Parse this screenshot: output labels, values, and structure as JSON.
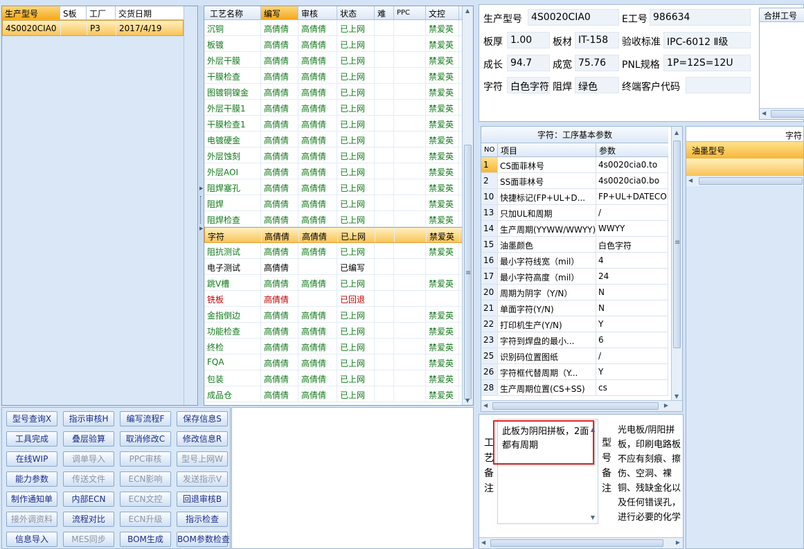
{
  "left_list": {
    "columns": [
      "生产型号",
      "S板",
      "工厂",
      "交货日期"
    ],
    "rows": [
      {
        "model": "4S0020CIA0",
        "s": "",
        "factory": "P3",
        "date": "2017/4/19"
      }
    ]
  },
  "process": {
    "columns": [
      "工艺名称",
      "编写",
      "审核",
      "状态",
      "难",
      "PPC",
      "文控"
    ],
    "rows": [
      {
        "name": "沉铜",
        "write": "高倩倩",
        "review": "高倩倩",
        "status": "已上网",
        "hard": "",
        "ppc": "",
        "doc": "禁爱英",
        "style": "green"
      },
      {
        "name": "板镀",
        "write": "高倩倩",
        "review": "高倩倩",
        "status": "已上网",
        "hard": "",
        "ppc": "",
        "doc": "禁爱英",
        "style": "green"
      },
      {
        "name": "外层干膜",
        "write": "高倩倩",
        "review": "高倩倩",
        "status": "已上网",
        "hard": "",
        "ppc": "",
        "doc": "禁爱英",
        "style": "green"
      },
      {
        "name": "干膜检查",
        "write": "高倩倩",
        "review": "高倩倩",
        "status": "已上网",
        "hard": "",
        "ppc": "",
        "doc": "禁爱英",
        "style": "green"
      },
      {
        "name": "图镀铜镍金",
        "write": "高倩倩",
        "review": "高倩倩",
        "status": "已上网",
        "hard": "",
        "ppc": "",
        "doc": "禁爱英",
        "style": "green"
      },
      {
        "name": "外层干膜1",
        "write": "高倩倩",
        "review": "高倩倩",
        "status": "已上网",
        "hard": "",
        "ppc": "",
        "doc": "禁爱英",
        "style": "green"
      },
      {
        "name": "干膜检查1",
        "write": "高倩倩",
        "review": "高倩倩",
        "status": "已上网",
        "hard": "",
        "ppc": "",
        "doc": "禁爱英",
        "style": "green"
      },
      {
        "name": "电镀硬金",
        "write": "高倩倩",
        "review": "高倩倩",
        "status": "已上网",
        "hard": "",
        "ppc": "",
        "doc": "禁爱英",
        "style": "green"
      },
      {
        "name": "外层蚀刻",
        "write": "高倩倩",
        "review": "高倩倩",
        "status": "已上网",
        "hard": "",
        "ppc": "",
        "doc": "禁爱英",
        "style": "green"
      },
      {
        "name": "外层AOI",
        "write": "高倩倩",
        "review": "高倩倩",
        "status": "已上网",
        "hard": "",
        "ppc": "",
        "doc": "禁爱英",
        "style": "green"
      },
      {
        "name": "阻焊塞孔",
        "write": "高倩倩",
        "review": "高倩倩",
        "status": "已上网",
        "hard": "",
        "ppc": "",
        "doc": "禁爱英",
        "style": "green"
      },
      {
        "name": "阻焊",
        "write": "高倩倩",
        "review": "高倩倩",
        "status": "已上网",
        "hard": "",
        "ppc": "",
        "doc": "禁爱英",
        "style": "green"
      },
      {
        "name": "阻焊检查",
        "write": "高倩倩",
        "review": "高倩倩",
        "status": "已上网",
        "hard": "",
        "ppc": "",
        "doc": "禁爱英",
        "style": "green"
      },
      {
        "name": "字符",
        "write": "高倩倩",
        "review": "高倩倩",
        "status": "已上网",
        "hard": "",
        "ppc": "",
        "doc": "禁爱英",
        "style": "hl"
      },
      {
        "name": "阻抗测试",
        "write": "高倩倩",
        "review": "高倩倩",
        "status": "已上网",
        "hard": "",
        "ppc": "",
        "doc": "禁爱英",
        "style": "green"
      },
      {
        "name": "电子测试",
        "write": "高倩倩",
        "review": "",
        "status": "已编写",
        "hard": "",
        "ppc": "",
        "doc": "",
        "style": "black"
      },
      {
        "name": "跳V槽",
        "write": "高倩倩",
        "review": "高倩倩",
        "status": "已上网",
        "hard": "",
        "ppc": "",
        "doc": "禁爱英",
        "style": "green"
      },
      {
        "name": "铣板",
        "write": "高倩倩",
        "review": "",
        "status": "已回退",
        "hard": "",
        "ppc": "",
        "doc": "",
        "style": "red"
      },
      {
        "name": "金指倒边",
        "write": "高倩倩",
        "review": "高倩倩",
        "status": "已上网",
        "hard": "",
        "ppc": "",
        "doc": "禁爱英",
        "style": "green"
      },
      {
        "name": "功能检查",
        "write": "高倩倩",
        "review": "高倩倩",
        "status": "已上网",
        "hard": "",
        "ppc": "",
        "doc": "禁爱英",
        "style": "green"
      },
      {
        "name": "终检",
        "write": "高倩倩",
        "review": "高倩倩",
        "status": "已上网",
        "hard": "",
        "ppc": "",
        "doc": "禁爱英",
        "style": "green"
      },
      {
        "name": "FQA",
        "write": "高倩倩",
        "review": "高倩倩",
        "status": "已上网",
        "hard": "",
        "ppc": "",
        "doc": "禁爱英",
        "style": "green"
      },
      {
        "name": "包装",
        "write": "高倩倩",
        "review": "高倩倩",
        "status": "已上网",
        "hard": "",
        "ppc": "",
        "doc": "禁爱英",
        "style": "green"
      },
      {
        "name": "成品仓",
        "write": "高倩倩",
        "review": "高倩倩",
        "status": "已上网",
        "hard": "",
        "ppc": "",
        "doc": "禁爱英",
        "style": "green"
      }
    ]
  },
  "buttons": [
    [
      {
        "label": "型号查询X",
        "enabled": true
      },
      {
        "label": "指示审核H",
        "enabled": true
      },
      {
        "label": "编写流程F",
        "enabled": true
      },
      {
        "label": "保存信息S",
        "enabled": true
      }
    ],
    [
      {
        "label": "工具完成",
        "enabled": true
      },
      {
        "label": "叠层验算",
        "enabled": true
      },
      {
        "label": "取消修改C",
        "enabled": true
      },
      {
        "label": "修改信息R",
        "enabled": true
      }
    ],
    [
      {
        "label": "在线WIP",
        "enabled": true
      },
      {
        "label": "调单导入",
        "enabled": false
      },
      {
        "label": "PPC审核",
        "enabled": false
      },
      {
        "label": "型号上网W",
        "enabled": false
      }
    ],
    [
      {
        "label": "能力参数",
        "enabled": true
      },
      {
        "label": "传送文件",
        "enabled": false
      },
      {
        "label": "ECN影响",
        "enabled": false
      },
      {
        "label": "发送指示V",
        "enabled": false
      }
    ],
    [
      {
        "label": "制作通知单",
        "enabled": true
      },
      {
        "label": "内部ECN",
        "enabled": true
      },
      {
        "label": "ECN文控",
        "enabled": false
      },
      {
        "label": "回退审核B",
        "enabled": true
      }
    ],
    [
      {
        "label": "接外调资料",
        "enabled": false
      },
      {
        "label": "流程对比",
        "enabled": true
      },
      {
        "label": "ECN升级",
        "enabled": false
      },
      {
        "label": "指示检查",
        "enabled": true
      }
    ],
    [
      {
        "label": "信息导入",
        "enabled": true
      },
      {
        "label": "MES同步",
        "enabled": false
      },
      {
        "label": "BOM生成",
        "enabled": true
      },
      {
        "label": "BOM参数检查",
        "enabled": true
      }
    ]
  ],
  "info": {
    "model_label": "生产型号",
    "model_value": "4S0020CIA0",
    "eno_label": "E工号",
    "eno_value": "986634",
    "thick_label": "板厚",
    "thick_value": "1.00",
    "material_label": "板材",
    "material_value": "IT-158",
    "standard_label": "验收标准",
    "standard_value": "IPC-6012 Ⅱ级",
    "length_label": "成长",
    "length_value": "94.7",
    "width_label": "成宽",
    "width_value": "75.76",
    "pnl_label": "PNL规格",
    "pnl_value": "1P=12S=12U",
    "char_label": "字符",
    "char_value": "白色字符",
    "mask_label": "阻焊",
    "mask_value": "绿色",
    "customer_label": "终端客户代码",
    "customer_value": "",
    "merge_label": "合拼工号"
  },
  "params": {
    "title": "字符：工序基本参数",
    "col_no": "NO",
    "col_item": "项目",
    "col_param": "参数",
    "rows": [
      {
        "no": "1",
        "item": "CS面菲林号",
        "param": "4s0020cia0.to"
      },
      {
        "no": "2",
        "item": "SS面菲林号",
        "param": "4s0020cia0.bo"
      },
      {
        "no": "10",
        "item": "快捷标记(FP+UL+D...",
        "param": "FP+UL+DATECODE"
      },
      {
        "no": "13",
        "item": "只加UL和周期",
        "param": "/"
      },
      {
        "no": "14",
        "item": "生产周期(YYWW/WWYY)",
        "param": "WWYY"
      },
      {
        "no": "15",
        "item": "油墨颜色",
        "param": "白色字符"
      },
      {
        "no": "16",
        "item": "最小字符线宽（mil）",
        "param": "4"
      },
      {
        "no": "17",
        "item": "最小字符高度（mil）",
        "param": "24"
      },
      {
        "no": "20",
        "item": "周期为阴字（Y/N）",
        "param": "N"
      },
      {
        "no": "21",
        "item": "单面字符(Y/N)",
        "param": "N"
      },
      {
        "no": "22",
        "item": "打印机生产(Y/N)",
        "param": "Y"
      },
      {
        "no": "23",
        "item": "字符到焊盘的最小...",
        "param": "6"
      },
      {
        "no": "25",
        "item": "识别码位置图纸",
        "param": "/"
      },
      {
        "no": "26",
        "item": "字符框代替周期（Y...",
        "param": "Y"
      },
      {
        "no": "28",
        "item": "生产周期位置(CS+SS)",
        "param": "cs"
      }
    ]
  },
  "ink": {
    "title_partial": "字符",
    "col": "油墨型号"
  },
  "notes": {
    "process_label": "工艺备注",
    "process_text": "此板为阴阳拼板，2面都有周期",
    "model_label": "型号备注",
    "model_text": "光电板/阴阳拼板，印刷电路板不应有刻痕、擦伤、空洞、裸铜、残缺金化以及任何错误孔，进行必要的化学检验和自动光"
  }
}
